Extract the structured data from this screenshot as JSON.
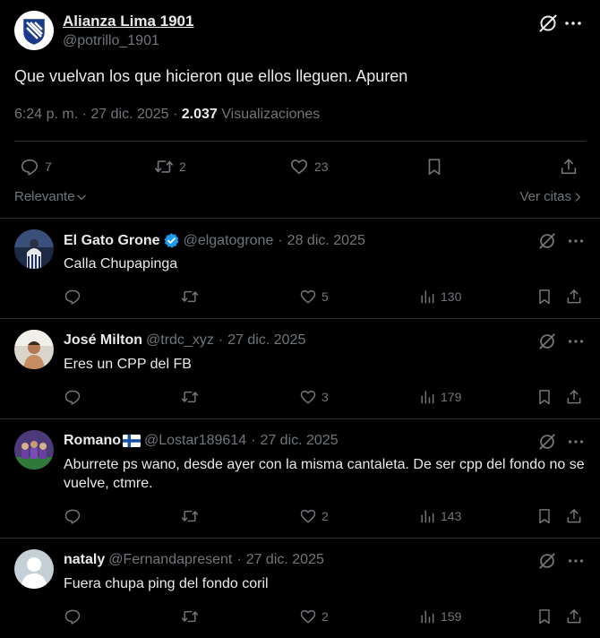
{
  "tweet": {
    "author_name": "Alianza Lima 1901",
    "author_handle": "@potrillo_1901",
    "text": "Que vuelvan los que hicieron que ellos lleguen. Apuren",
    "time": "6:24 p. m. · 27 dic. 2025 ·",
    "views_count": "2.037",
    "views_label": "Visualizaciones",
    "replies": "7",
    "retweets": "2",
    "likes": "23"
  },
  "sort": {
    "label": "Relevante",
    "quotes_link": "Ver citas"
  },
  "replies": [
    {
      "name": "El Gato Grone",
      "handle": "@elgatogrone",
      "date": "28 dic. 2025",
      "text": "Calla Chupapinga",
      "replies": "",
      "retweets": "",
      "likes": "5",
      "views": "130",
      "verified": true
    },
    {
      "name": "José Milton",
      "handle": "@trdc_xyz",
      "date": "27 dic. 2025",
      "text": "Eres un CPP del FB",
      "replies": "",
      "retweets": "",
      "likes": "3",
      "views": "179"
    },
    {
      "name": "Romano",
      "handle": "@Lostar189614",
      "date": "27 dic. 2025",
      "text": "Aburrete ps wano, desde ayer con la misma cantaleta. De ser cpp del fondo no se vuelve, ctmre.",
      "replies": "",
      "retweets": "",
      "likes": "2",
      "views": "143",
      "flag": "finland"
    },
    {
      "name": "nataly",
      "handle": "@Fernandapresent",
      "date": "27 dic. 2025",
      "text": "Fuera chupa ping del fondo coril",
      "replies": "",
      "retweets": "",
      "likes": "2",
      "views": "159"
    }
  ],
  "colors": {
    "background": "#000000",
    "text": "#e7e9ea",
    "muted": "#71767b",
    "divider": "#2f3336",
    "verified": "#1d9bf0"
  }
}
